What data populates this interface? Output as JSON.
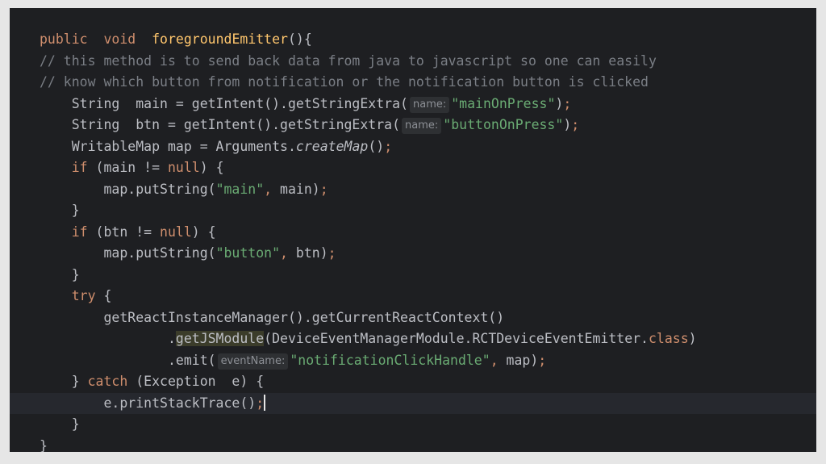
{
  "editor": {
    "lines": [
      {
        "indent": "",
        "tokens": [
          {
            "t": "public",
            "c": "kw"
          },
          {
            "t": "  "
          },
          {
            "t": "void",
            "c": "kw"
          },
          {
            "t": "  "
          },
          {
            "t": "foregroundEmitter",
            "c": "decl"
          },
          {
            "t": "(){"
          }
        ]
      },
      {
        "indent": "",
        "tokens": [
          {
            "t": "// this method is to send back data from java to javascript so one can easily",
            "c": "cm"
          }
        ]
      },
      {
        "indent": "",
        "tokens": [
          {
            "t": "// know which button from notification or the notification button is clicked",
            "c": "cm"
          }
        ]
      },
      {
        "indent": "    ",
        "tokens": [
          {
            "t": "String  main = getIntent().getStringExtra("
          },
          {
            "t": "name:",
            "c": "hint"
          },
          {
            "t": "\"mainOnPress\"",
            "c": "str"
          },
          {
            "t": ")"
          },
          {
            "t": ";",
            "c": "kw"
          }
        ]
      },
      {
        "indent": "    ",
        "tokens": [
          {
            "t": "String  btn = getIntent().getStringExtra("
          },
          {
            "t": "name:",
            "c": "hint"
          },
          {
            "t": "\"buttonOnPress\"",
            "c": "str"
          },
          {
            "t": ")"
          },
          {
            "t": ";",
            "c": "kw"
          }
        ]
      },
      {
        "indent": "    ",
        "tokens": [
          {
            "t": "WritableMap map = Arguments."
          },
          {
            "t": "createMap",
            "c": "it"
          },
          {
            "t": "()"
          },
          {
            "t": ";",
            "c": "kw"
          }
        ]
      },
      {
        "indent": "    ",
        "tokens": [
          {
            "t": "if",
            "c": "kw"
          },
          {
            "t": " (main != "
          },
          {
            "t": "null",
            "c": "kw"
          },
          {
            "t": ") {"
          }
        ]
      },
      {
        "indent": "        ",
        "tokens": [
          {
            "t": "map.putString("
          },
          {
            "t": "\"main\"",
            "c": "str"
          },
          {
            "t": ",",
            "c": "kw"
          },
          {
            "t": " main)"
          },
          {
            "t": ";",
            "c": "kw"
          }
        ]
      },
      {
        "indent": "    ",
        "tokens": [
          {
            "t": "}"
          }
        ]
      },
      {
        "indent": "    ",
        "tokens": [
          {
            "t": "if",
            "c": "kw"
          },
          {
            "t": " (btn != "
          },
          {
            "t": "null",
            "c": "kw"
          },
          {
            "t": ") {"
          }
        ]
      },
      {
        "indent": "        ",
        "tokens": [
          {
            "t": "map.putString("
          },
          {
            "t": "\"button\"",
            "c": "str"
          },
          {
            "t": ",",
            "c": "kw"
          },
          {
            "t": " btn)"
          },
          {
            "t": ";",
            "c": "kw"
          }
        ]
      },
      {
        "indent": "    ",
        "tokens": [
          {
            "t": "}"
          }
        ]
      },
      {
        "indent": "    ",
        "tokens": [
          {
            "t": "try",
            "c": "kw"
          },
          {
            "t": " {"
          }
        ]
      },
      {
        "indent": "        ",
        "tokens": [
          {
            "t": "getReactInstanceManager().getCurrentReactContext()"
          }
        ]
      },
      {
        "indent": "                ",
        "tokens": [
          {
            "t": "."
          },
          {
            "t": "getJSModule",
            "c": "hl"
          },
          {
            "t": "(DeviceEventManagerModule.RCTDeviceEventEmitter."
          },
          {
            "t": "class",
            "c": "kw"
          },
          {
            "t": ")"
          }
        ]
      },
      {
        "indent": "                ",
        "tokens": [
          {
            "t": ".emit("
          },
          {
            "t": "eventName:",
            "c": "hint"
          },
          {
            "t": "\"notificationClickHandle\"",
            "c": "str"
          },
          {
            "t": ",",
            "c": "kw"
          },
          {
            "t": " map)"
          },
          {
            "t": ";",
            "c": "kw"
          }
        ]
      },
      {
        "indent": "    ",
        "tokens": [
          {
            "t": "} "
          },
          {
            "t": "catch",
            "c": "kw"
          },
          {
            "t": " (Exception  e) {"
          }
        ]
      },
      {
        "indent": "        ",
        "current": true,
        "tokens": [
          {
            "t": "e.printStackTrace()"
          },
          {
            "t": ";",
            "c": "kw"
          },
          {
            "t": "",
            "c": "caret"
          }
        ]
      },
      {
        "indent": "    ",
        "tokens": [
          {
            "t": "}"
          }
        ]
      },
      {
        "indent": "",
        "tokens": [
          {
            "t": "}"
          }
        ]
      }
    ]
  },
  "colors": {
    "background": "#1e1f22",
    "keyword": "#cf8e6d",
    "method_declaration": "#ffc66d",
    "string": "#6aab73",
    "comment": "#7a7e85",
    "default_text": "#bcbec4"
  }
}
